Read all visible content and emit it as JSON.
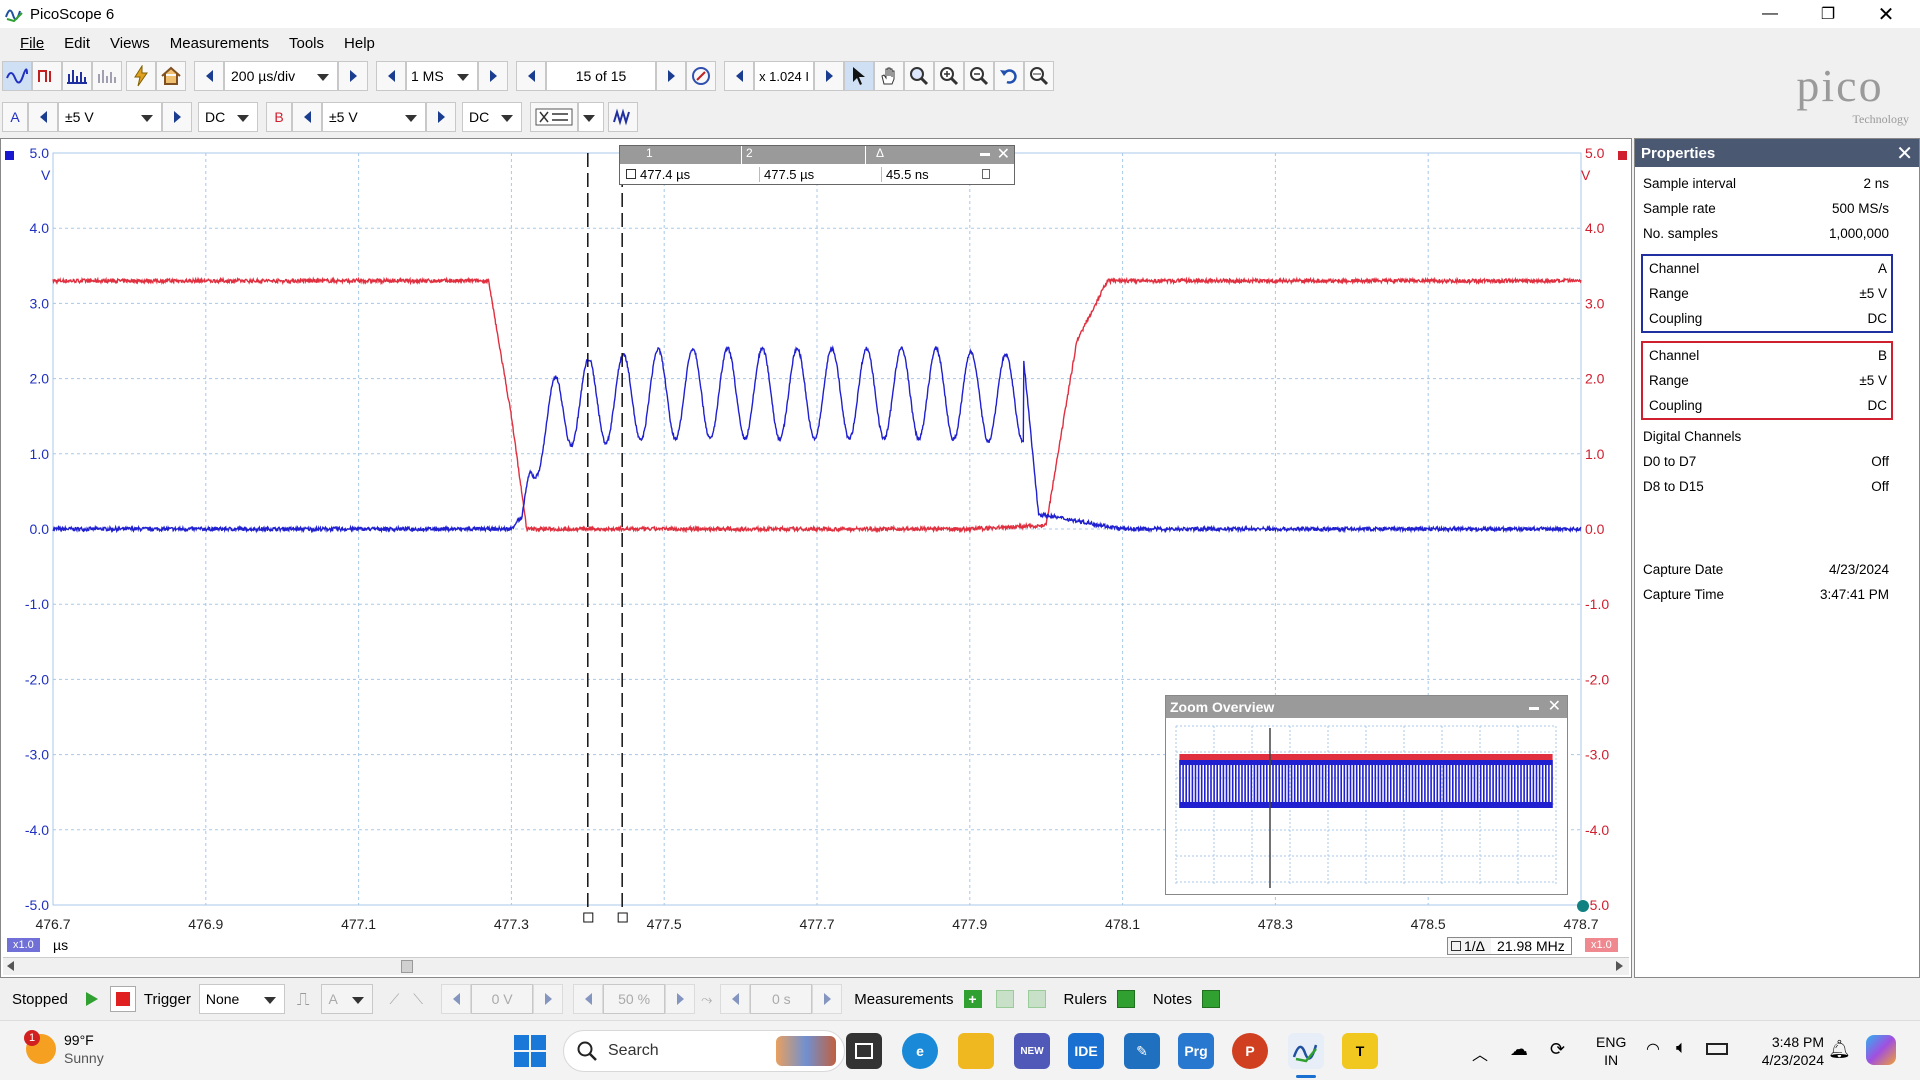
{
  "app": {
    "title": "PicoScope 6",
    "logo_text": "pico",
    "logo_sub": "Technology"
  },
  "menu": [
    "File",
    "Edit",
    "Views",
    "Measurements",
    "Tools",
    "Help"
  ],
  "toolbar": {
    "timebase": "200 µs/div",
    "samples": "1 MS",
    "buffer": "15 of 15",
    "zoom": "x 1.024 I",
    "chA_label": "A",
    "chA_range": "±5 V",
    "chA_coupling": "DC",
    "chB_label": "B",
    "chB_range": "±5 V",
    "chB_coupling": "DC"
  },
  "scope": {
    "y_ticks": [
      "5.0",
      "4.0",
      "3.0",
      "2.0",
      "1.0",
      "0.0",
      "-1.0",
      "-2.0",
      "-3.0",
      "-4.0",
      "-5.0"
    ],
    "y_unit": "V",
    "x_ticks": [
      "476.7",
      "476.9",
      "477.1",
      "477.3",
      "477.5",
      "477.7",
      "477.9",
      "478.1",
      "478.3",
      "478.5",
      "478.7"
    ],
    "x_unit": "µs",
    "x_zoom_left": "x1.0",
    "x_zoom_right": "x1.0",
    "freq_label": "1/Δ",
    "freq_value": "21.98 MHz",
    "ruler_table": {
      "headers": [
        "1",
        "2",
        "Δ"
      ],
      "values": [
        "477.4 µs",
        "477.5 µs",
        "45.5 ns"
      ]
    },
    "zoom_overview_title": "Zoom Overview"
  },
  "chart_data": {
    "type": "line",
    "x_unit": "µs",
    "xlim": [
      476.7,
      478.7
    ],
    "ylim": [
      -5.0,
      5.0
    ],
    "series": [
      {
        "name": "A",
        "color": "#2020d0",
        "x": [
          476.7,
          477.2,
          477.3,
          477.314,
          477.325,
          477.36,
          477.43,
          477.5,
          477.85,
          477.97,
          477.99,
          478.1,
          478.7
        ],
        "y": [
          0.0,
          0.0,
          0.0,
          0.2,
          1.5,
          2.2,
          2.3,
          2.4,
          2.4,
          2.3,
          0.2,
          0.0,
          0.0
        ]
      },
      {
        "name": "B",
        "color": "#e03040",
        "x": [
          476.7,
          477.27,
          477.3,
          477.32,
          477.9,
          478.0,
          478.04,
          478.08,
          478.7
        ],
        "y": [
          3.3,
          3.3,
          1.5,
          0.0,
          0.0,
          0.05,
          2.5,
          3.3,
          3.3
        ]
      }
    ],
    "oscillation": {
      "period_us": 0.0455,
      "start_us": 477.31,
      "end_us": 477.97,
      "low": 1.2,
      "high": 2.4
    },
    "cursors_us": [
      477.4,
      477.445
    ]
  },
  "properties": {
    "title": "Properties",
    "general": [
      [
        "Sample interval",
        "2 ns"
      ],
      [
        "Sample rate",
        "500 MS/s"
      ],
      [
        "No. samples",
        "1,000,000"
      ]
    ],
    "channel_a": [
      [
        "Channel",
        "A"
      ],
      [
        "Range",
        "±5 V"
      ],
      [
        "Coupling",
        "DC"
      ]
    ],
    "channel_b": [
      [
        "Channel",
        "B"
      ],
      [
        "Range",
        "±5 V"
      ],
      [
        "Coupling",
        "DC"
      ]
    ],
    "digital_title": "Digital Channels",
    "digital": [
      [
        "D0 to D7",
        "Off"
      ],
      [
        "D8 to D15",
        "Off"
      ]
    ],
    "capture": [
      [
        "Capture Date",
        "4/23/2024"
      ],
      [
        "Capture Time",
        "3:47:41 PM"
      ]
    ]
  },
  "statusbar": {
    "state": "Stopped",
    "trigger_label": "Trigger",
    "trigger_mode": "None",
    "trigger_channel": "A",
    "trigger_level": "0 V",
    "pretrigger": "50 %",
    "delay": "0 s",
    "measurements": "Measurements",
    "rulers": "Rulers",
    "notes": "Notes"
  },
  "taskbar": {
    "weather_temp": "99°F",
    "weather_desc": "Sunny",
    "weather_badge": "1",
    "search": "Search",
    "lang": "ENG",
    "region": "IN",
    "time": "3:48 PM",
    "date": "4/23/2024",
    "icon_ide": "IDE",
    "icon_prg": "Prg",
    "icon_t": "T",
    "icon_new": "NEW",
    "icon_p": "P"
  }
}
